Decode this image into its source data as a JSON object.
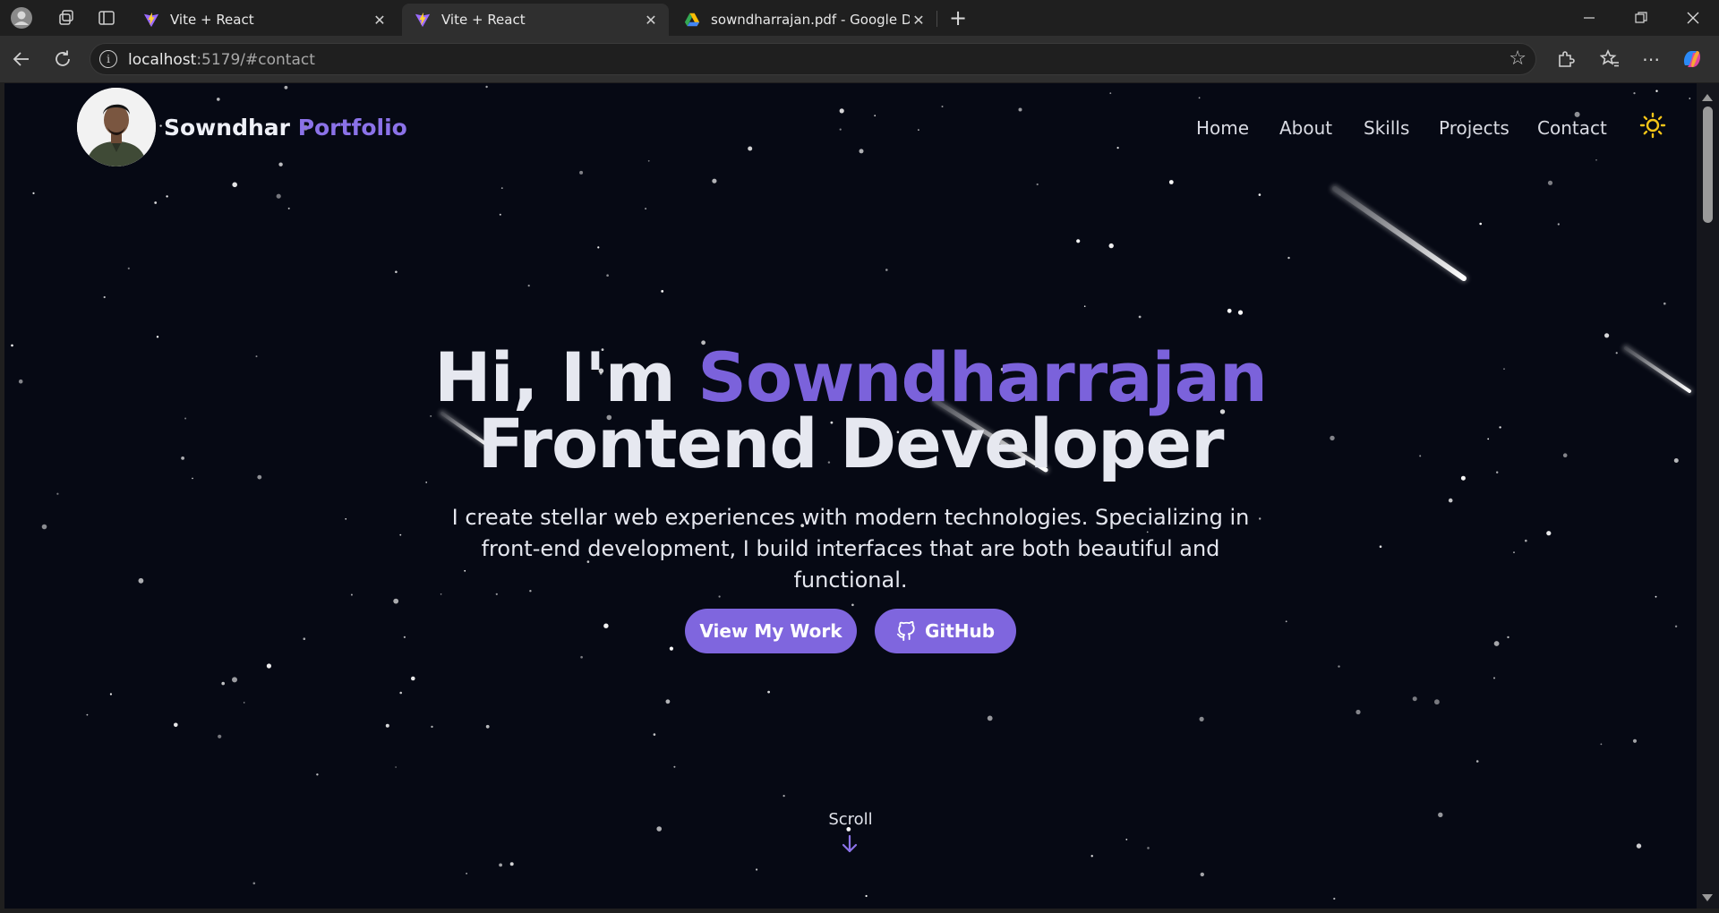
{
  "browser": {
    "tabs": [
      {
        "title": "Vite + React",
        "active": false
      },
      {
        "title": "Vite + React",
        "active": true
      },
      {
        "title": "sowndharrajan.pdf - Google Drive",
        "active": false
      }
    ],
    "url_host": "localhost",
    "url_rest": ":5179/#contact"
  },
  "site": {
    "brand_first": "Sowndhar",
    "brand_second": "Portfolio",
    "nav": [
      "Home",
      "About",
      "Skills",
      "Projects",
      "Contact"
    ],
    "hero": {
      "greeting": "Hi, I'm ",
      "name": "Sowndharrajan",
      "role": "Frontend Developer",
      "description": "I create stellar web experiences with modern technologies. Specializing in front-end development, I build interfaces that are both beautiful and functional.",
      "primary_button": "View My Work",
      "secondary_button": "GitHub"
    },
    "scroll_label": "Scroll"
  },
  "colors": {
    "background": "#060914",
    "accent": "#7f66de",
    "accent_text": "#8b72e8",
    "sun": "#f5c518"
  }
}
